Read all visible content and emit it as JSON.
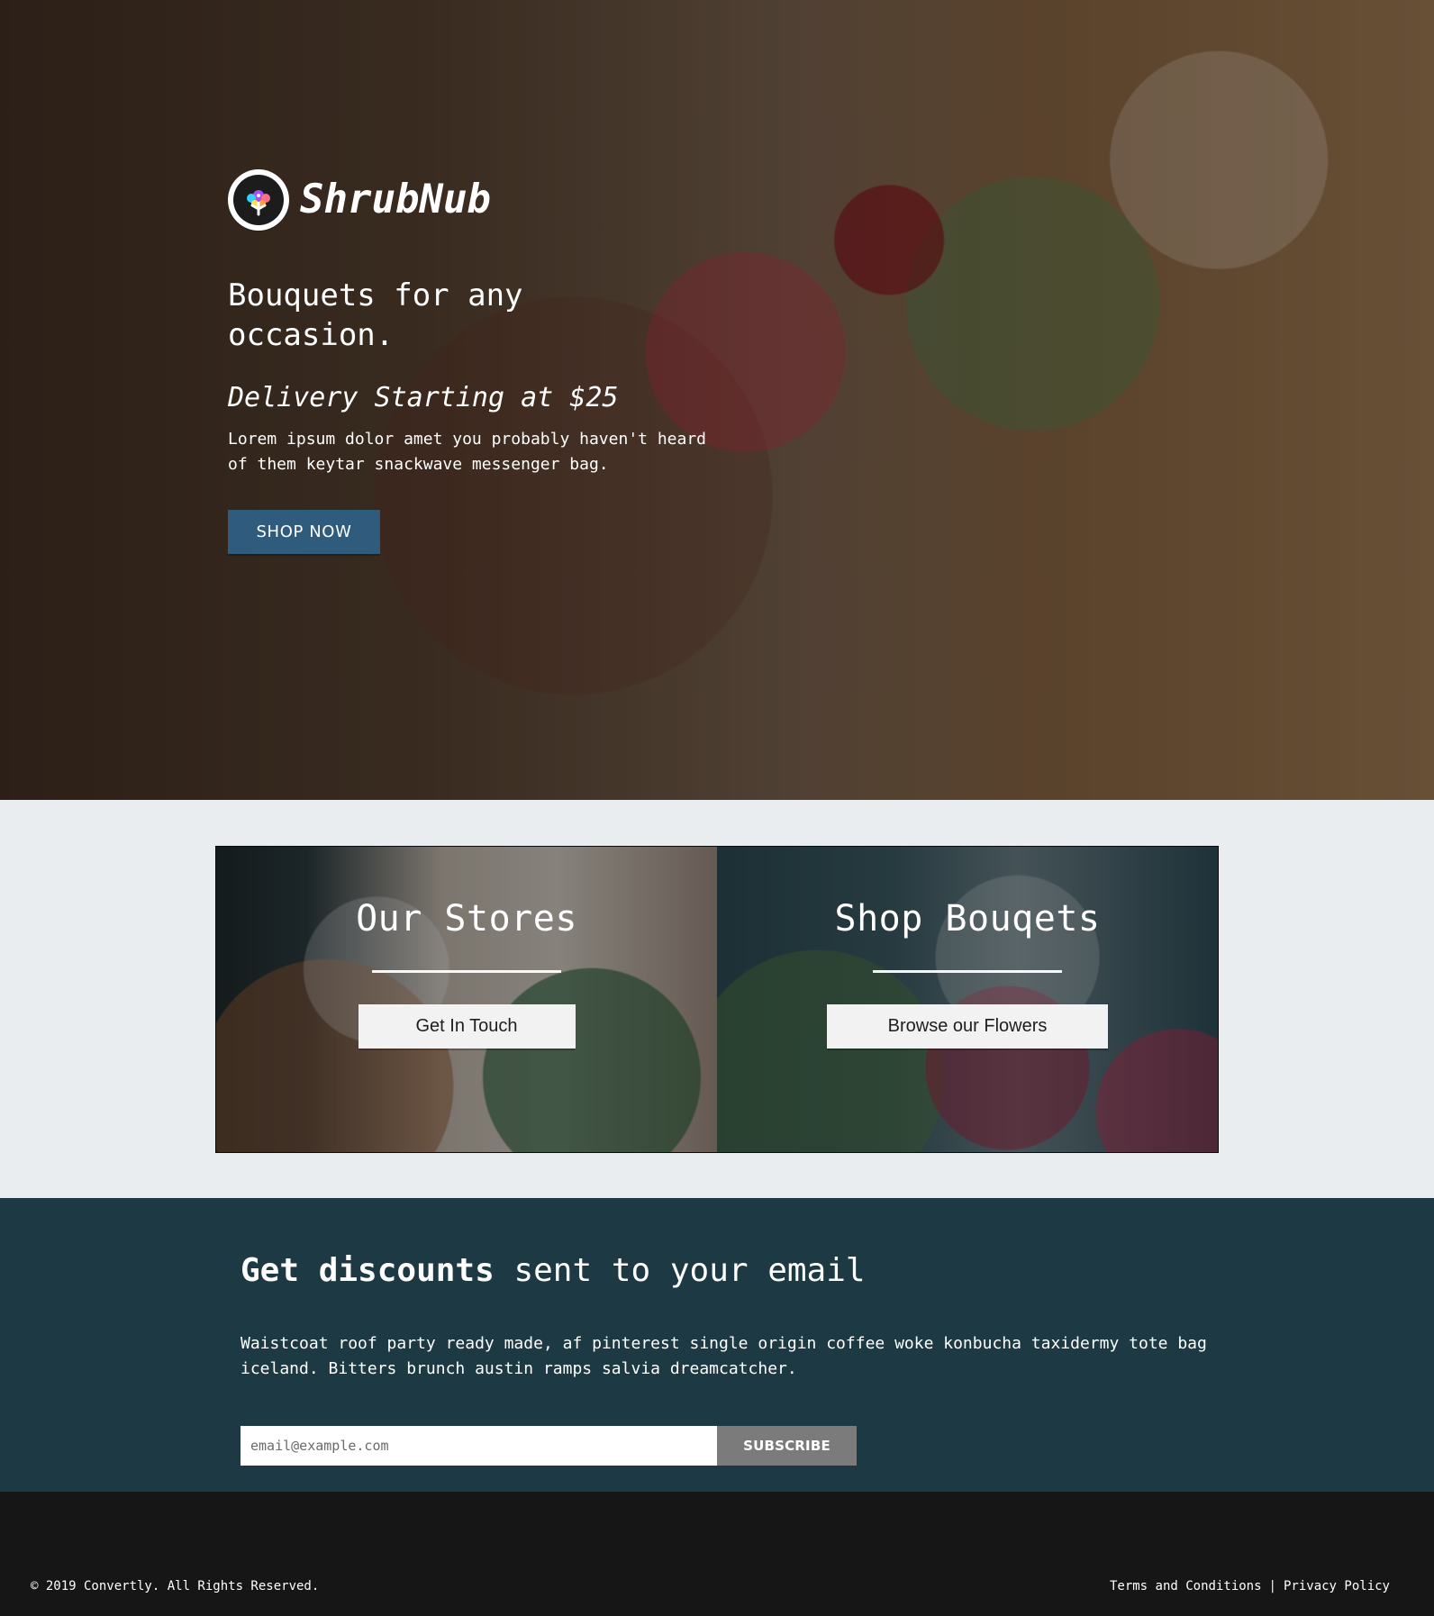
{
  "brand": {
    "name": "ShrubNub"
  },
  "hero": {
    "headline": "Bouquets for any occasion.",
    "subheadline": "Delivery Starting at $25",
    "body": "Lorem ipsum dolor amet you probably haven't heard of them keytar snackwave messenger bag.",
    "cta_label": "SHOP NOW"
  },
  "cards": [
    {
      "title": "Our Stores",
      "button_label": "Get In Touch"
    },
    {
      "title": "Shop Bouqets",
      "button_label": "Browse our Flowers"
    }
  ],
  "email_signup": {
    "title_bold": "Get discounts",
    "title_rest": "sent to your email",
    "body": "Waistcoat roof party ready made, af pinterest single origin coffee woke konbucha taxidermy tote bag iceland. Bitters brunch austin ramps salvia dreamcatcher.",
    "email_placeholder": "email@example.com",
    "email_value": "",
    "subscribe_label": "SUBSCRIBE"
  },
  "footer": {
    "copyright": "© 2019 Convertly. All Rights Reserved.",
    "links": {
      "terms": "Terms and Conditions",
      "separator": "|",
      "privacy": "Privacy Policy"
    }
  },
  "colors": {
    "primary_button": "#2f5b7c",
    "section_light": "#e9edf0",
    "section_dark": "#1d3944",
    "footer_bg": "#161616",
    "subscribe_button": "#7b7b7b"
  },
  "icons": {
    "brand_logo": "bouquet-logo-icon"
  }
}
